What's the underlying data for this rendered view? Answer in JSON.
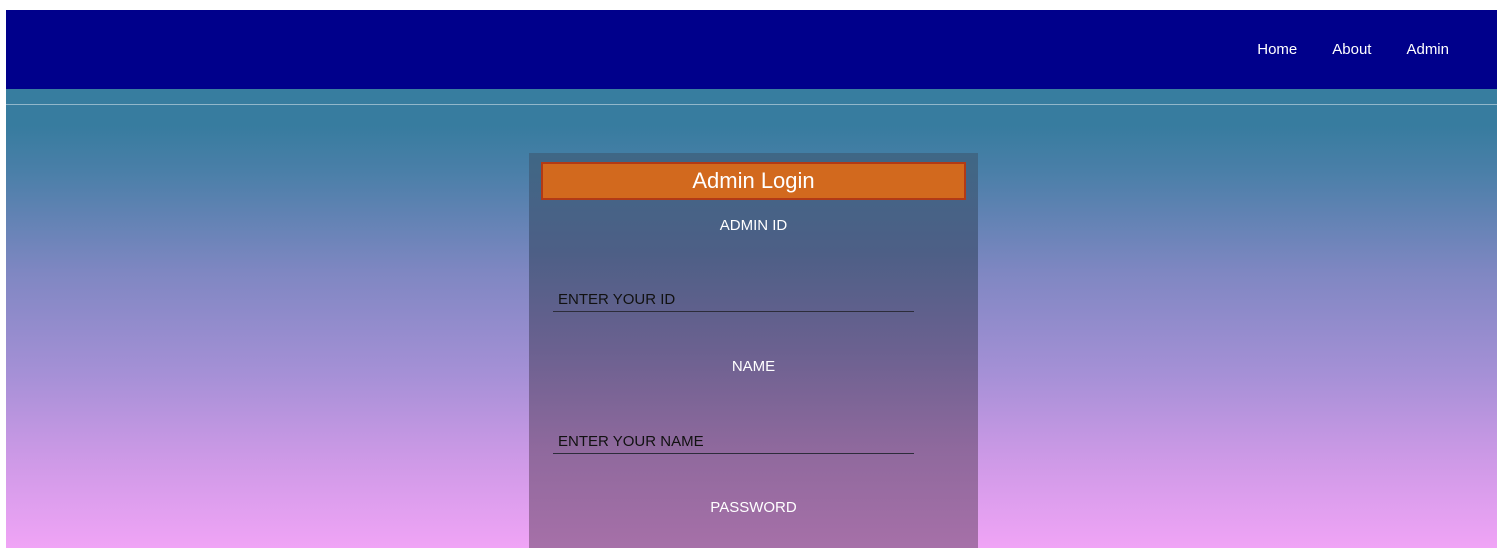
{
  "nav": {
    "links": [
      "Home",
      "About",
      "Admin"
    ]
  },
  "login": {
    "title": "Admin Login",
    "fields": [
      {
        "label": "ADMIN ID",
        "placeholder": "ENTER YOUR ID",
        "value": ""
      },
      {
        "label": "NAME",
        "placeholder": "ENTER YOUR NAME",
        "value": ""
      },
      {
        "label": "PASSWORD"
      }
    ]
  },
  "colors": {
    "navbar": "#00008b",
    "title_bar": "#d2691e",
    "title_border": "#b23a16",
    "gradient_top": "#377d9f",
    "gradient_bottom": "#f0a4f6"
  }
}
